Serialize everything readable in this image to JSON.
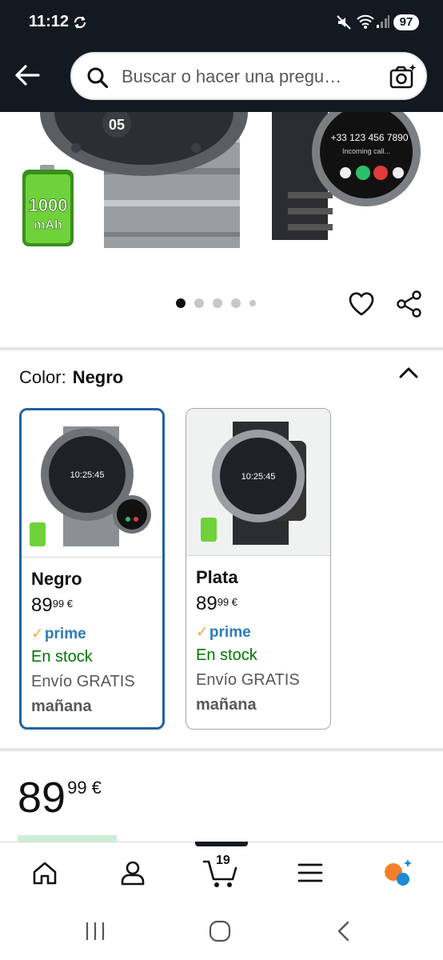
{
  "status_bar": {
    "time": "11:12",
    "battery": "97"
  },
  "search": {
    "placeholder": "Buscar o hacer una pregu…"
  },
  "product_image": {
    "badge_line1": "1000",
    "badge_line2": "mAh",
    "phone_number": "+33 123 456 7890",
    "incoming_text": "Incoming call..."
  },
  "carousel": {
    "dots": 5,
    "active_index": 0
  },
  "color_selector": {
    "label": "Color:",
    "selected_value": "Negro",
    "options": [
      {
        "name": "Negro",
        "price_whole": "89",
        "price_fraction": "99 €",
        "prime": "prime",
        "stock": "En stock",
        "shipping": "Envío GRATIS",
        "shipping_day": "mañana",
        "selected": true
      },
      {
        "name": "Plata",
        "price_whole": "89",
        "price_fraction": "99 €",
        "prime": "prime",
        "stock": "En stock",
        "shipping": "Envío GRATIS",
        "shipping_day": "mañana",
        "selected": false
      }
    ]
  },
  "price": {
    "whole": "89",
    "fraction": "99 €"
  },
  "bottom_nav": {
    "cart_count": "19",
    "items": [
      "home-icon",
      "account-icon",
      "cart-icon",
      "menu-icon",
      "rufus-icon"
    ]
  },
  "colors": {
    "header_bg": "#131921",
    "link_blue": "#2162a1",
    "prime_blue": "#2b7bb9",
    "stock_green": "#007600",
    "prime_orange": "#f3a847"
  }
}
